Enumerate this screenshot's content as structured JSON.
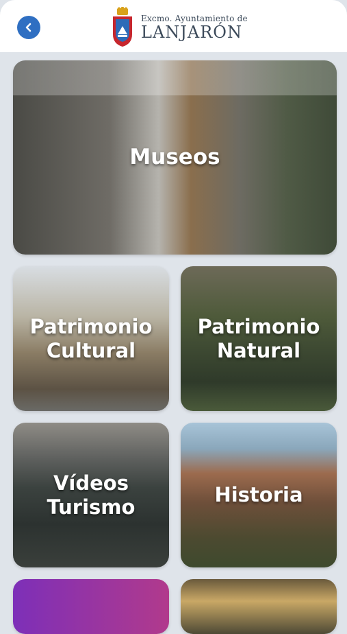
{
  "header": {
    "logo_line1": "Excmo. Ayuntamiento de",
    "logo_line2": "LANJARÓN",
    "back_icon": "chevron-left-icon",
    "accent": "#2f6fc2"
  },
  "tiles": [
    {
      "label": "Museos"
    },
    {
      "label": "Patrimonio\nCultural"
    },
    {
      "label": "Patrimonio\nNatural"
    },
    {
      "label": "Vídeos\nTurismo"
    },
    {
      "label": "Historia"
    },
    {
      "label": ""
    },
    {
      "label": ""
    }
  ]
}
